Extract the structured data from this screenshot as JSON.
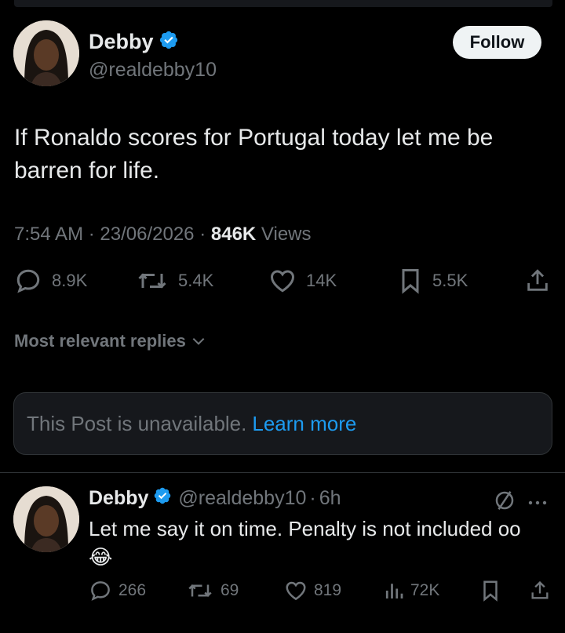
{
  "tweet": {
    "author_name": "Debby",
    "author_handle": "@realdebby10",
    "follow_label": "Follow",
    "text": "If Ronaldo scores for Portugal today let me be barren for life.",
    "time": "7:54 AM",
    "date": "23/06/2026",
    "views_count": "846K",
    "views_label": "Views",
    "separator": "·",
    "replies": "8.9K",
    "reposts": "5.4K",
    "likes": "14K",
    "bookmarks": "5.5K"
  },
  "replies_sort": {
    "label": "Most relevant replies"
  },
  "unavailable_notice": {
    "text": "This Post is unavailable.",
    "link": "Learn more"
  },
  "reply": {
    "author_name": "Debby",
    "author_handle": "@realdebby10",
    "separator": "·",
    "age": "6h",
    "text": "Let me say it on time. Penalty is not included oo",
    "emoji": "😂",
    "replies": "266",
    "reposts": "69",
    "likes": "819",
    "views": "72K"
  },
  "colors": {
    "background": "#000000",
    "text_primary": "#e7e9ea",
    "text_secondary": "#71767b",
    "accent": "#1d9bf0",
    "verified": "#1d9bf0",
    "card_bg": "#16181c"
  },
  "icons": [
    "verified-badge-icon",
    "reply-icon",
    "repost-icon",
    "like-icon",
    "bookmark-icon",
    "share-icon",
    "chevron-down-icon",
    "grok-icon",
    "more-icon",
    "views-icon"
  ]
}
